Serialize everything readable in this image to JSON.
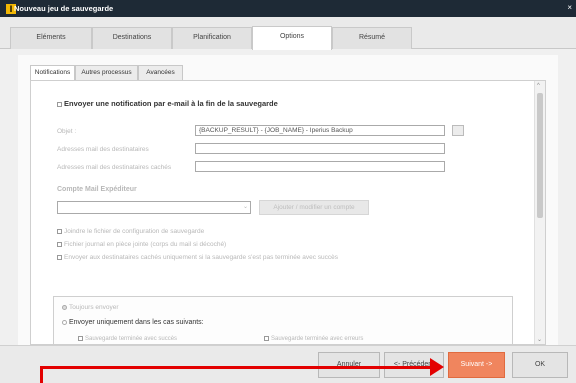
{
  "window": {
    "title": "Nouveau jeu de sauvegarde",
    "logo_glyph": "I",
    "close_glyph": "×"
  },
  "tabs": [
    {
      "label": "Eléments"
    },
    {
      "label": "Destinations"
    },
    {
      "label": "Planification"
    },
    {
      "label": "Options"
    },
    {
      "label": "Résumé"
    }
  ],
  "subtabs": [
    {
      "label": "Notifications"
    },
    {
      "label": "Autres processus"
    },
    {
      "label": "Avancées"
    }
  ],
  "notif": {
    "enable_label": "Envoyer une notification par e-mail à la fin de la sauvegarde",
    "subject_label": "Objet :",
    "subject_value": "{BACKUP_RESULT} - {JOB_NAME} - Iperius Backup",
    "recipients_label": "Adresses mail des destinataires",
    "bcc_label": "Adresses mail des destinataires cachés",
    "sender_section": "Compte Mail Expéditeur",
    "add_account_button": "Ajouter / modifier un compte",
    "attach_config": "Joindre le fichier de configuration de sauvegarde",
    "attach_log": "Fichier journal en pièce jointe (corps du mail si décoché)",
    "send_hidden_only": "Envoyer aux destinataires cachés uniquement si la sauvegarde s'est pas terminée avec succès",
    "always_send": "Toujours envoyer",
    "send_only_cases": "Envoyer uniquement dans les cas suivants:",
    "case_success_no_errors": "Sauvegarde terminée avec succès",
    "case_error": "Sauvegarde terminée avec erreurs"
  },
  "footer": {
    "cancel": "Annuler",
    "back": "<- Précédent",
    "next": "Suivant ->",
    "ok": "OK"
  },
  "colors": {
    "primary_button": "#f0855e",
    "annotation_arrow": "#e30000",
    "titlebar": "#1e2a36"
  }
}
